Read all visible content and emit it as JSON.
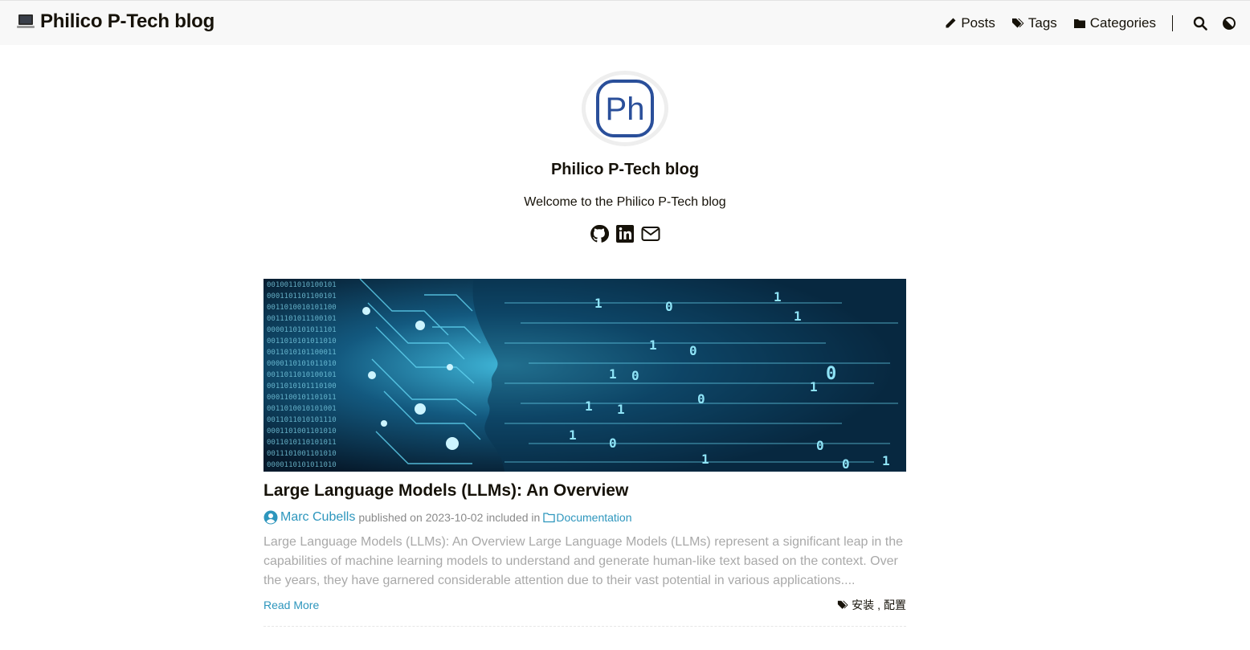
{
  "navbar": {
    "brand": "Philico P-Tech blog",
    "links": [
      {
        "label": "Posts",
        "icon": "pencil-icon"
      },
      {
        "label": "Tags",
        "icon": "tags-icon"
      },
      {
        "label": "Categories",
        "icon": "folder-icon"
      }
    ],
    "search_icon": "search-icon",
    "theme_icon": "theme-toggle-icon"
  },
  "profile": {
    "avatar_text": "Ph",
    "title": "Philico P-Tech blog",
    "subtitle": "Welcome to the Philico P-Tech blog",
    "social": [
      "github-icon",
      "linkedin-icon",
      "email-icon"
    ]
  },
  "posts": [
    {
      "title": "Large Language Models (LLMs): An Overview",
      "author": "Marc Cubells",
      "published_prefix": "published on",
      "date": "2023-10-02",
      "included_in": "included in",
      "category": "Documentation",
      "summary": "Large Language Models (LLMs): An Overview Large Language Models (LLMs) represent a significant leap in the capabilities of machine learning models to understand and generate human-like text based on the context. Over the years, they have garnered considerable attention due to their vast potential in various applications....",
      "read_more": "Read More",
      "tags": [
        "安装",
        "配置"
      ],
      "tag_separator": ","
    }
  ],
  "colors": {
    "accent": "#2d96bd",
    "text": "#161209",
    "muted": "#a9a9a9",
    "navbar_bg": "#f8f8f8",
    "avatar_blue": "#2a4f9a"
  }
}
